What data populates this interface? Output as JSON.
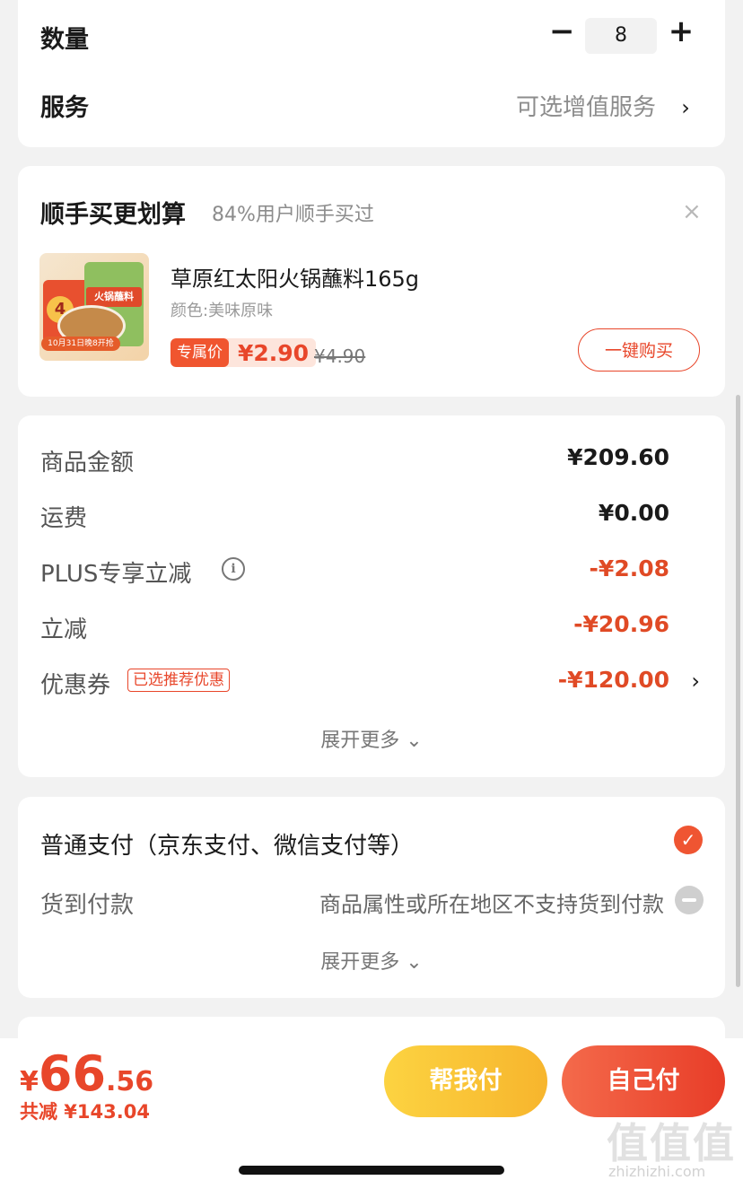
{
  "quantity": {
    "label": "数量",
    "value": "8",
    "minus": "−",
    "plus": "+"
  },
  "service": {
    "label": "服务",
    "value": "可选增值服务",
    "chevron": "›"
  },
  "addon": {
    "title": "顺手买更划算",
    "subtitle": "84%用户顺手买过",
    "close": "×",
    "product": {
      "image_badge": "4",
      "image_band": "火锅蘸料",
      "image_ribbon": "10月31日晚8开抢",
      "name": "草原红太阳火锅蘸料165g",
      "spec": "颜色:美味原味",
      "price_tag": "专属价",
      "price": "¥2.90",
      "original_price": "¥4.90",
      "buy_label": "一键购买"
    }
  },
  "summary": {
    "rows": [
      {
        "label": "商品金额",
        "value": "¥209.60"
      },
      {
        "label": "运费",
        "value": "¥0.00"
      },
      {
        "label": "PLUS专享立减",
        "value": "-¥2.08"
      },
      {
        "label": "立减",
        "value": "-¥20.96"
      },
      {
        "label": "优惠券",
        "value": "-¥120.00",
        "tag": "已选推荐优惠"
      }
    ],
    "info_icon": "i",
    "chevron": "›",
    "expand": "展开更多 ⌄"
  },
  "payment": {
    "title": "普通支付（京东支付、微信支付等）",
    "check": "✓",
    "cod_label": "货到付款",
    "cod_note": "商品属性或所在地区不支持货到付款",
    "expand": "展开更多 ⌄"
  },
  "bottom": {
    "currency": "¥",
    "total_int": "66",
    "total_dec": ".56",
    "saved": "共减 ¥143.04",
    "help_pay": "帮我付",
    "self_pay": "自己付"
  },
  "watermark": {
    "logo": "值值值",
    "url": "zhizhizhi.com"
  },
  "colors": {
    "accent": "#e8462a",
    "help_button": "#f9c338",
    "background": "#f2f2f2"
  }
}
